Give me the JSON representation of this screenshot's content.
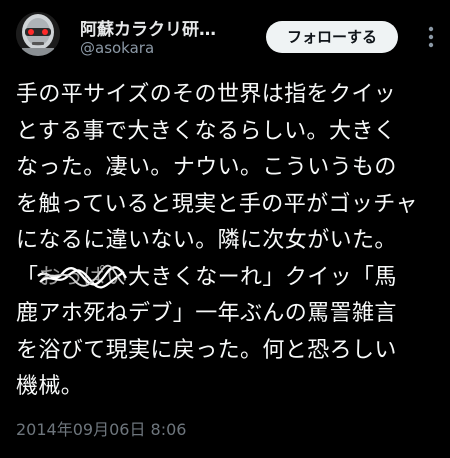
{
  "profile": {
    "display_name": "阿蘇カラクリ研…",
    "handle": "@asokara",
    "avatar_icon": "robot-face-icon"
  },
  "actions": {
    "follow_label": "フォローする",
    "more_icon": "more-vertical-icon"
  },
  "tweet": {
    "lines": [
      "手の平サイズのその世界は指をクイッ",
      "とする事で大きくなるらしい。大きく",
      "なった。凄い。ナウい。こういうもの",
      "を触っていると現実と手の平がゴッチャ",
      "になるに違いない。隣に次女がいた。",
      "鹿アホ死ねデブ」一年ぶんの罵詈雑言",
      "を浴びて現実に戻った。何と恐ろしい",
      "機械。"
    ],
    "line6": {
      "open_bracket": "「",
      "redacted": "おっぱい",
      "rest": "大きくなーれ」クイッ「馬"
    }
  },
  "timestamp": "2014年09月06日 8:06",
  "colors": {
    "background": "#000000",
    "text": "#e7e9ea",
    "secondary": "#6e767d",
    "button_bg": "#eff3f4",
    "button_text": "#0f1419"
  }
}
